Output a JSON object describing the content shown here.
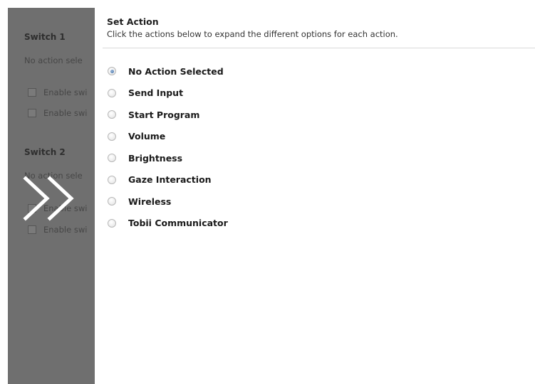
{
  "background_panel": {
    "switch1_heading": "Switch 1",
    "switch1_status": "No action sele",
    "switch1_check_a": "Enable swi",
    "switch1_check_b": "Enable swi",
    "switch2_heading": "Switch 2",
    "switch2_status": "No action sele",
    "switch2_check_a": "Enable swi",
    "switch2_check_b": "Enable swi"
  },
  "overlay": {
    "icon": "double-chevron-right-icon"
  },
  "popup": {
    "title": "Set Action",
    "subtitle": "Click the actions below to expand the different options for each action.",
    "options": [
      {
        "label": "No Action Selected",
        "selected": true
      },
      {
        "label": "Send Input",
        "selected": false
      },
      {
        "label": "Start Program",
        "selected": false
      },
      {
        "label": "Volume",
        "selected": false
      },
      {
        "label": "Brightness",
        "selected": false
      },
      {
        "label": "Gaze Interaction",
        "selected": false
      },
      {
        "label": "Wireless",
        "selected": false
      },
      {
        "label": "Tobii Communicator",
        "selected": false
      }
    ]
  },
  "colors": {
    "panel_bg": "#6f6f6f",
    "popup_bg": "#ffffff",
    "radio_selected": "#3e6ea8"
  }
}
